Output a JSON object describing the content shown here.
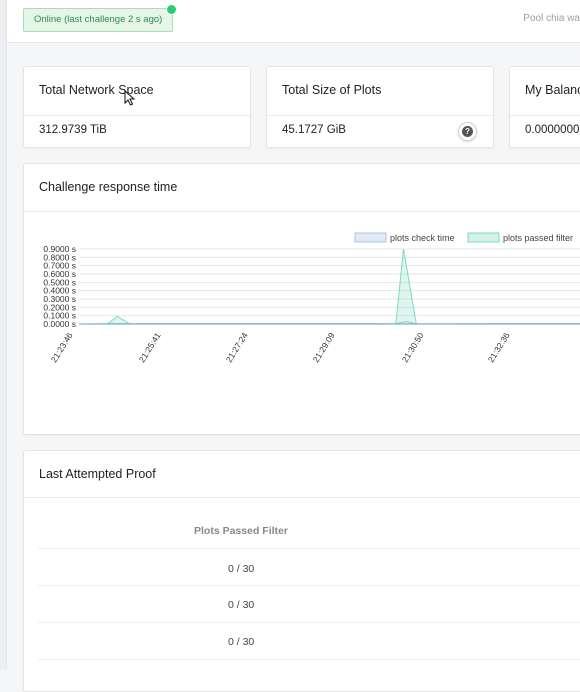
{
  "header": {
    "status_text": "Online (last challenge 2 s ago)",
    "pool_text": "Pool chia wa"
  },
  "stats": [
    {
      "title": "Total Network Space",
      "value": "312.9739 TiB"
    },
    {
      "title": "Total Size of Plots",
      "value": "45.1727 GiB",
      "help_icon": "question-icon"
    },
    {
      "title": "My Balanc",
      "value": "0.0000000"
    }
  ],
  "challenge_panel": {
    "title": "Challenge response time",
    "chart_data": {
      "type": "area",
      "title": "",
      "xlabel": "",
      "ylabel": "",
      "ylim": [
        0,
        0.9
      ],
      "y_unit": "s",
      "y_ticks": [
        "0.9000 s",
        "0.8000 s",
        "0.7000 s",
        "0.6000 s",
        "0.5000 s",
        "0.4000 s",
        "0.3000 s",
        "0.2000 s",
        "0.1000 s",
        "0.0000 s"
      ],
      "x_ticks": [
        "21:23:46",
        "21:25:41",
        "21:27:24",
        "21:29:09",
        "21:30:50",
        "21:32:36"
      ],
      "legend_position": "top-right",
      "series": [
        {
          "name": "plots check time",
          "color": "#aac4e0",
          "points": [
            [
              0,
              0
            ],
            [
              0.075,
              0.005
            ],
            [
              0.1,
              0.005
            ],
            [
              0.165,
              0.005
            ],
            [
              0.35,
              0.005
            ],
            [
              0.52,
              0.005
            ],
            [
              0.62,
              0.004
            ],
            [
              0.64,
              0.03
            ],
            [
              0.66,
              0.004
            ],
            [
              0.8,
              0.005
            ],
            [
              1,
              0.005
            ]
          ]
        },
        {
          "name": "plots passed filter",
          "color": "#7fd9c1",
          "points": [
            [
              0,
              0
            ],
            [
              0.055,
              0
            ],
            [
              0.075,
              0.09
            ],
            [
              0.1,
              0
            ],
            [
              0.62,
              0
            ],
            [
              0.635,
              0.9
            ],
            [
              0.66,
              0
            ],
            [
              1,
              0
            ]
          ]
        }
      ]
    }
  },
  "proof_panel": {
    "title": "Last Attempted Proof",
    "column_header": "Plots Passed Filter",
    "rows": [
      "0 / 30",
      "0 / 30",
      "0 / 30"
    ]
  }
}
